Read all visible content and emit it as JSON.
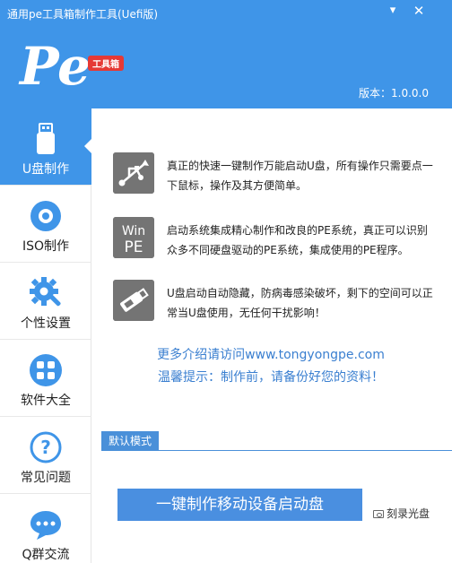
{
  "window": {
    "title": "通用pe工具箱制作工具(Uefi版)",
    "minimize_glyph": "▾",
    "close_glyph": "✕"
  },
  "logo": {
    "text": "Pe",
    "badge": "工具箱"
  },
  "version": "版本：1.0.0.0",
  "colors": {
    "accent": "#3f95e8",
    "button": "#4a8fe0",
    "link": "#3a7fd0",
    "icon_bg": "#747474",
    "badge": "#e53935"
  },
  "sidebar": {
    "items": [
      {
        "label": "U盘制作",
        "icon": "usb-drive-icon",
        "active": true
      },
      {
        "label": "ISO制作",
        "icon": "disc-icon",
        "active": false
      },
      {
        "label": "个性设置",
        "icon": "gear-icon",
        "active": false
      },
      {
        "label": "软件大全",
        "icon": "apps-grid-icon",
        "active": false
      },
      {
        "label": "常见问题",
        "icon": "help-icon",
        "active": false
      },
      {
        "label": "Q群交流",
        "icon": "chat-icon",
        "active": false
      }
    ]
  },
  "features": [
    {
      "icon": "usb-symbol-icon",
      "text": "真正的快速一键制作万能启动U盘，所有操作只需要点一下鼠标，操作及其方便简单。"
    },
    {
      "icon": "win-pe-icon",
      "icon_text_1": "Win",
      "icon_text_2": "PE",
      "text": "启动系统集成精心制作和改良的PE系统，真正可以识别众多不同硬盘驱动的PE系统，集成使用的PE程序。"
    },
    {
      "icon": "usb-stick-icon",
      "text": "U盘启动自动隐藏，防病毒感染破坏，剩下的空间可以正常当U盘使用，无任何干扰影响！"
    }
  ],
  "more_link": "更多介绍请访问www.tongyongpe.com",
  "tips": "温馨提示：制作前，请备份好您的资料！",
  "mode_tab": "默认模式",
  "make_button": "一键制作移动设备启动盘",
  "burn_button": "刻录光盘"
}
